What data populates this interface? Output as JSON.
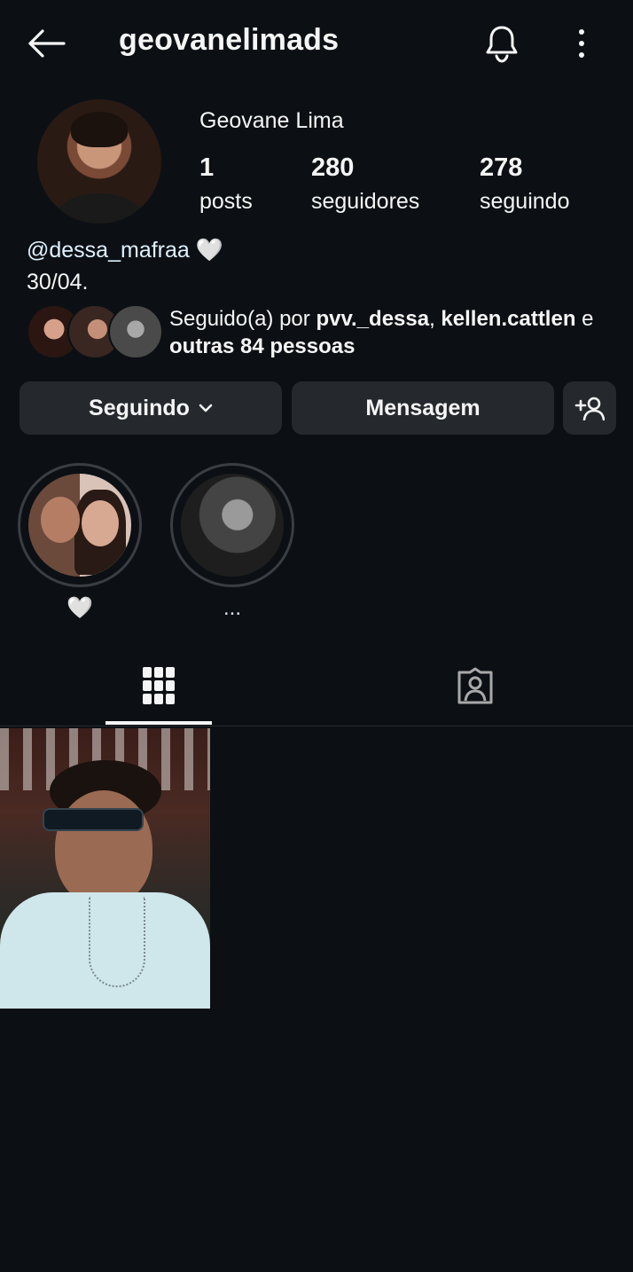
{
  "header": {
    "username": "geovanelimads",
    "back_icon": "arrow-left-icon",
    "bell_icon": "bell-icon",
    "more_icon": "more-vertical-icon"
  },
  "profile": {
    "display_name": "Geovane Lima",
    "stats": [
      {
        "value": "1",
        "label": "posts"
      },
      {
        "value": "280",
        "label": "seguidores"
      },
      {
        "value": "278",
        "label": "seguindo"
      }
    ],
    "bio_mention": "@dessa_mafraa",
    "bio_emoji": "🤍",
    "bio_line2": "30/04."
  },
  "mutual": {
    "prefix": "Seguido(a) por ",
    "user1": "pvv._dessa",
    "separator": ", ",
    "user2": "kellen.cattlen",
    "conj": " e",
    "others": "outras 84 pessoas"
  },
  "actions": {
    "following_label": "Seguindo",
    "message_label": "Mensagem"
  },
  "highlights": [
    {
      "label": "🤍"
    },
    {
      "label": "..."
    }
  ],
  "tabs": {
    "grid_icon": "grid-icon",
    "tagged_icon": "tagged-person-icon"
  },
  "colors": {
    "background": "#0c1014",
    "button": "#25292e",
    "text": "#f5f5f5",
    "mention": "#e0f1ff"
  }
}
